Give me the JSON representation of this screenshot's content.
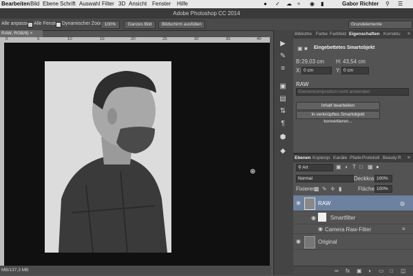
{
  "menubar": {
    "items": [
      "Bearbeiten",
      "Bild",
      "Ebene",
      "Schrift",
      "Auswahl",
      "Filter",
      "3D",
      "Ansicht",
      "Fenster",
      "Hilfe"
    ],
    "user": "Gabor Richter"
  },
  "window": {
    "title": "Adobe Photoshop CC 2014"
  },
  "options": {
    "fit_label": "Alle anpassen",
    "all_windows": "Alle Fenster",
    "dyn_zoom": "Dynamischer Zoom",
    "btn_100": "100%",
    "btn_whole": "Ganzes Bild",
    "btn_fill": "Bildschirm ausfüllen",
    "workspace": "Grundelemente"
  },
  "document": {
    "tab": "RAW, RGB/8)",
    "status": "MB/137,3 MB"
  },
  "ruler": {
    "ticks": [
      "0",
      "5",
      "10",
      "15",
      "20",
      "25",
      "30",
      "35",
      "40"
    ]
  },
  "properties": {
    "tabs": [
      "Bibliothe",
      "Farbe",
      "Farbfeld",
      "Eigenschaften",
      "Korrektu"
    ],
    "header": "Eingebettetes Smartobjekt",
    "b_label": "B:",
    "b_value": "29,03 cm",
    "h_label": "H:",
    "h_value": "43,54 cm",
    "x_label": "X:",
    "x_value": "0 cm",
    "y_label": "Y:",
    "y_value": "0 cm",
    "layer_name": "RAW",
    "comp_placeholder": "Ebenenkomposition nicht anwenden",
    "edit_btn": "Inhalt bearbeiten",
    "convert_btn": "In verknüpftes Smartobjekt konvertieren..."
  },
  "layers": {
    "tabs": [
      "Ebenen",
      "Kopierqs",
      "Kanäle",
      "Pfade",
      "Protokoll",
      "Beauty R"
    ],
    "kind": "Art",
    "blend": "Normal",
    "opacity_label": "Deckkraft:",
    "opacity": "100%",
    "lock_label": "Fixieren:",
    "fill_label": "Fläche:",
    "fill": "100%",
    "items": [
      {
        "name": "RAW"
      },
      {
        "name": "Smartfilter"
      },
      {
        "name": "Camera Raw-Filter"
      },
      {
        "name": "Original"
      }
    ]
  },
  "colors": {
    "selection": "#6d82a0",
    "canvas": "#101010"
  }
}
